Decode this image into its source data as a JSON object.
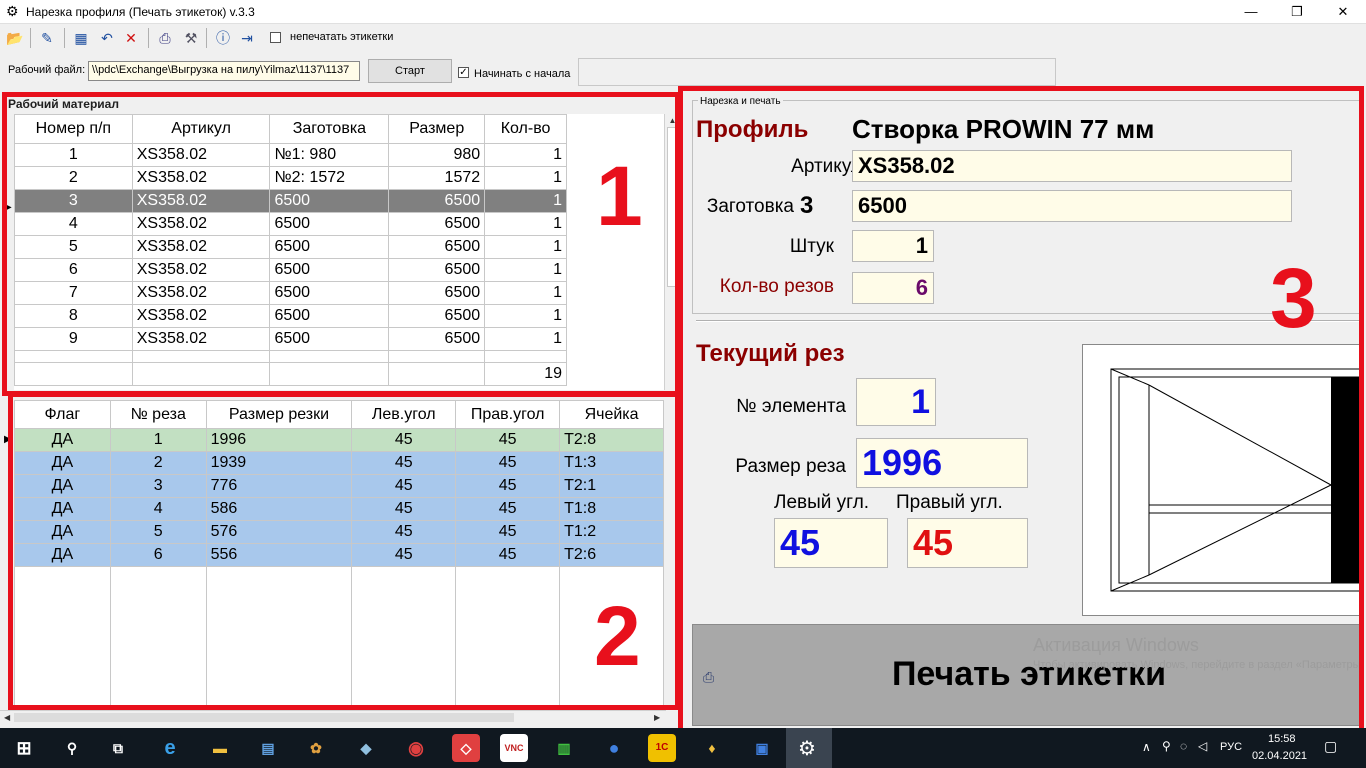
{
  "window": {
    "title": "Нарезка профиля (Печать этикеток) v.3.3",
    "app_icon": "gear-icon",
    "buttons": {
      "minimize": "—",
      "restore": "❐",
      "close": "✕"
    }
  },
  "toolbar": {
    "icons": [
      "open-folder-icon",
      "edit-pen-icon",
      "grid-icon",
      "undo-icon",
      "delete-icon",
      "print-icon",
      "hammer-icon",
      "info-icon",
      "exit-icon"
    ],
    "no_print_checkbox": {
      "label": "непечатать этикетки",
      "checked": false
    }
  },
  "file_row": {
    "label": "Рабочий файл:",
    "path": "\\\\pdc\\Exchange\\Выгрузка на пилу\\Yilmaz\\1137\\1137",
    "start_button": "Старт",
    "from_start_checkbox": {
      "label": "Начинать с начала",
      "checked": true
    }
  },
  "material": {
    "group_title": "Рабочий материал",
    "columns": [
      "Номер п/п",
      "Артикул",
      "Заготовка",
      "Размер",
      "Кол-во"
    ],
    "rows": [
      [
        "1",
        "XS358.02",
        "№1: 980",
        "980",
        "1"
      ],
      [
        "2",
        "XS358.02",
        "№2: 1572",
        "1572",
        "1"
      ],
      [
        "3",
        "XS358.02",
        "6500",
        "6500",
        "1"
      ],
      [
        "4",
        "XS358.02",
        "6500",
        "6500",
        "1"
      ],
      [
        "5",
        "XS358.02",
        "6500",
        "6500",
        "1"
      ],
      [
        "6",
        "XS358.02",
        "6500",
        "6500",
        "1"
      ],
      [
        "7",
        "XS358.02",
        "6500",
        "6500",
        "1"
      ],
      [
        "8",
        "XS358.02",
        "6500",
        "6500",
        "1"
      ],
      [
        "9",
        "XS358.02",
        "6500",
        "6500",
        "1"
      ]
    ],
    "selected_row": 2,
    "total": "19"
  },
  "cuts": {
    "columns": [
      "Флаг",
      "№ реза",
      "Размер резки",
      "Лев.угол",
      "Прав.угол",
      "Ячейка"
    ],
    "rows": [
      [
        "ДА",
        "1",
        "1996",
        "45",
        "45",
        "T2:8"
      ],
      [
        "ДА",
        "2",
        "1939",
        "45",
        "45",
        "T1:3"
      ],
      [
        "ДА",
        "3",
        "776",
        "45",
        "45",
        "T2:1"
      ],
      [
        "ДА",
        "4",
        "586",
        "45",
        "45",
        "T1:8"
      ],
      [
        "ДА",
        "5",
        "576",
        "45",
        "45",
        "T1:2"
      ],
      [
        "ДА",
        "6",
        "556",
        "45",
        "45",
        "T2:6"
      ]
    ]
  },
  "print_panel": {
    "group_title": "Нарезка и печать",
    "profile_label": "Профиль",
    "profile_name": "Створка PROWIN 77 мм",
    "article_label": "Артикул",
    "article_value": "XS358.02",
    "blank_label": "Заготовка",
    "blank_number": "3",
    "blank_value": "6500",
    "pieces_label": "Штук",
    "pieces_value": "1",
    "cuts_count_label": "Кол-во резов",
    "cuts_count_value": "6",
    "current_cut_title": "Текущий рез",
    "element_no_label": "№ элемента",
    "element_no_value": "1",
    "cut_size_label": "Размер реза",
    "cut_size_value": "1996",
    "left_angle_label": "Левый угл.",
    "left_angle_value": "45",
    "right_angle_label": "Правый угл.",
    "right_angle_value": "45",
    "print_button": "Печать этикетки",
    "watermark_line1": "Активация Windows",
    "watermark_line2": "Чтобы активировать Windows, перейдите в раздел «Параметры»."
  },
  "annotations": [
    "1",
    "2",
    "3"
  ],
  "taskbar": {
    "time": "15:58",
    "date": "02.04.2021",
    "lang": "РУС"
  },
  "colors": {
    "annotation_red": "#e8101c",
    "field_bg": "#fffce8",
    "row_green": "#c2e0c2",
    "row_blue": "#a8c8ec",
    "selected_row": "#808080",
    "dark_red": "#8b0000"
  }
}
